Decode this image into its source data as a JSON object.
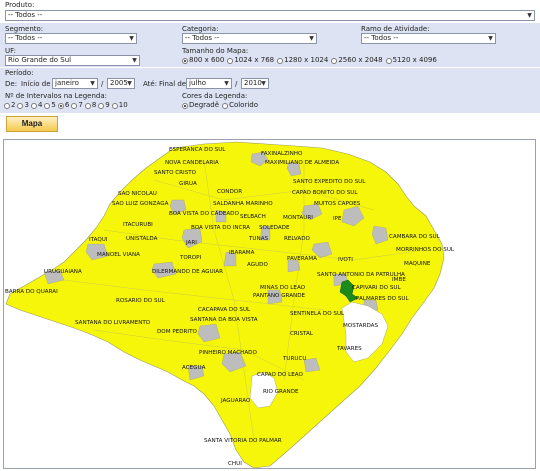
{
  "form": {
    "produto": {
      "label": "Produto:",
      "value": "-- Todos --"
    },
    "segmento": {
      "label": "Segmento:",
      "value": "-- Todos --"
    },
    "categoria": {
      "label": "Categoria:",
      "value": "-- Todos --"
    },
    "ramo": {
      "label": "Ramo de Atividade:",
      "value": "-- Todos --"
    },
    "uf": {
      "label": "UF:",
      "value": "Rio Grande do Sul"
    },
    "tamanho": {
      "label": "Tamanho do Mapa:",
      "options": [
        "800 x 600",
        "1024 x 768",
        "1280 x 1024",
        "2560 x 2048",
        "5120 x 4096"
      ],
      "selected": "800 x 600"
    },
    "periodo": {
      "label": "Período:",
      "de_label": "De:",
      "inicio_label": "Início de",
      "mes_inicio": "janeiro",
      "sep1": "/",
      "ano_inicio": "2005",
      "ate_label": "Até:",
      "final_label": "Final de",
      "mes_final": "julho",
      "sep2": "/",
      "ano_final": "2010"
    },
    "intervalos": {
      "label": "Nº de Intervalos na Legenda:",
      "options": [
        "2",
        "3",
        "4",
        "5",
        "6",
        "7",
        "8",
        "9",
        "10"
      ],
      "selected": "6"
    },
    "cores": {
      "label": "Cores da Legenda:",
      "options": [
        "Degradê",
        "Colorido"
      ],
      "selected": "Degradê"
    },
    "map_button": "Mapa"
  },
  "colors": {
    "map_fill": "#f6f60a",
    "map_stroke": "#9a9a60",
    "gray_region": "#bdbdbd",
    "green_region": "#1a8a1a",
    "band": "#dde3f3"
  },
  "map": {
    "cities": [
      "ESPERANCA DO SUL",
      "FAXINALZINHO",
      "NOVA CANDELARIA",
      "MAXIMILIANO DE ALMEIDA",
      "SANTO CRISTO",
      "SANTO EXPEDITO DO SUL",
      "GIRUA",
      "CAPAO BONITO DO SUL",
      "SAO NICOLAU",
      "CONDOR",
      "MUITOS CAPOES",
      "SAO LUIZ GONZAGA",
      "SALDANHA MARINHO",
      "MONTAURI",
      "BOA VISTA DO CADEADO",
      "SELBACH",
      "IPE",
      "ITACURUBI",
      "BOA VISTA DO INCRA",
      "SOLEDADE",
      "CAMBARA DO SUL",
      "UNISTALDA",
      "JARI",
      "TUNAS",
      "RELVADO",
      "ITAQUI",
      "MORRINHOS DO SUL",
      "MANOEL VIANA",
      "TOROPI",
      "IBARAMA",
      "PAVERAMA",
      "IVOTI",
      "MAQUINE",
      "AGUDO",
      "URUGUAIANA",
      "DILERMANDO DE AGUIAR",
      "SANTO ANTONIO DA PATRULHA",
      "IMBE",
      "MINAS DO LEAO",
      "CAPIVARI DO SUL",
      "BARRA DO QUARAI",
      "PANTANO GRANDE",
      "PALMARES DO SUL",
      "ROSARIO DO SUL",
      "CACAPAVA DO SUL",
      "SENTINELA DO SUL",
      "SANTANA DO LIVRAMENTO",
      "SANTANA DA BOA VISTA",
      "MOSTARDAS",
      "DOM PEDRITO",
      "CRISTAL",
      "TAVARES",
      "PINHEIRO MACHADO",
      "TURUCU",
      "ACEGUA",
      "CAPAO DO LEAO",
      "RIO GRANDE",
      "JAGUARAO",
      "SANTA VITORIA DO PALMAR",
      "CHUI"
    ]
  }
}
